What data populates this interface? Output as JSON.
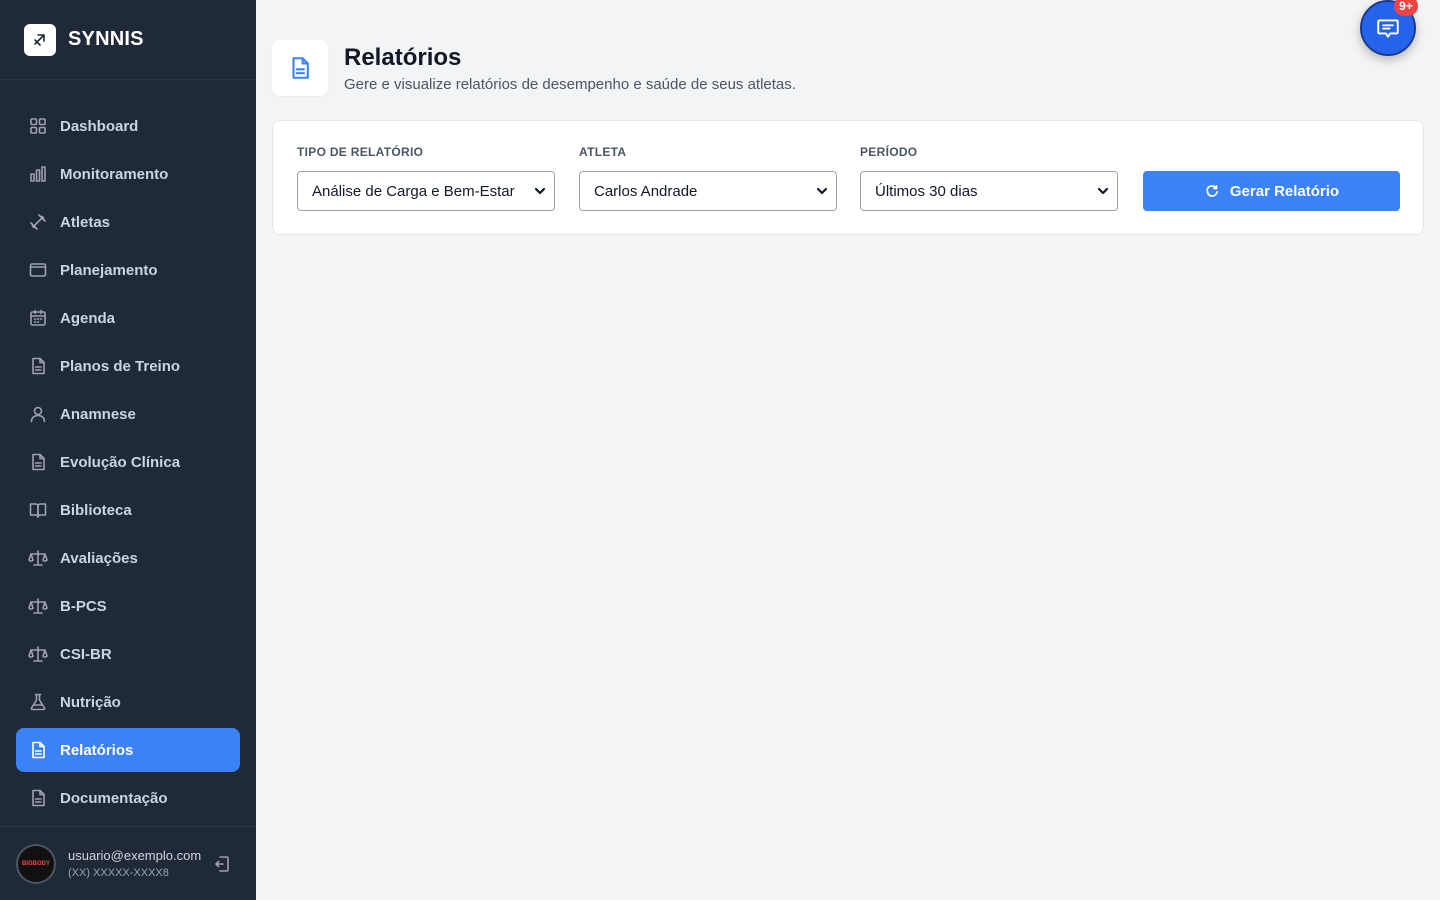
{
  "brand": {
    "name": "SYNNIS"
  },
  "sidebar": {
    "items": [
      {
        "label": "Dashboard",
        "icon": "grid-icon"
      },
      {
        "label": "Monitoramento",
        "icon": "bar-chart-icon"
      },
      {
        "label": "Atletas",
        "icon": "dumbbell-icon"
      },
      {
        "label": "Planejamento",
        "icon": "monitor-icon"
      },
      {
        "label": "Agenda",
        "icon": "calendar-icon"
      },
      {
        "label": "Planos de Treino",
        "icon": "document-icon"
      },
      {
        "label": "Anamnese",
        "icon": "user-icon"
      },
      {
        "label": "Evolução Clínica",
        "icon": "document-icon"
      },
      {
        "label": "Biblioteca",
        "icon": "book-icon"
      },
      {
        "label": "Avaliações",
        "icon": "scale-icon"
      },
      {
        "label": "B-PCS",
        "icon": "scale-icon"
      },
      {
        "label": "CSI-BR",
        "icon": "scale-icon"
      },
      {
        "label": "Nutrição",
        "icon": "flask-icon"
      },
      {
        "label": "Relatórios",
        "icon": "document-icon",
        "active": true
      },
      {
        "label": "Documentação",
        "icon": "document-icon"
      }
    ]
  },
  "user": {
    "email": "usuario@exemplo.com",
    "phone": "(XX) XXXXX-XXXX8",
    "avatar_text": "BIOBODY"
  },
  "header": {
    "title": "Relatórios",
    "subtitle": "Gere e visualize relatórios de desempenho e saúde de seus atletas."
  },
  "filters": {
    "report_type": {
      "label": "TIPO DE RELATÓRIO",
      "value": "Análise de Carga e Bem-Estar"
    },
    "athlete": {
      "label": "ATLETA",
      "value": "Carlos Andrade"
    },
    "period": {
      "label": "PERÍODO",
      "value": "Últimos 30 dias"
    },
    "generate_label": "Gerar Relatório"
  },
  "chat": {
    "badge": "9+"
  },
  "colors": {
    "accent": "#3b82f6",
    "sidebar_bg": "#1f2937",
    "badge": "#ef4444"
  }
}
